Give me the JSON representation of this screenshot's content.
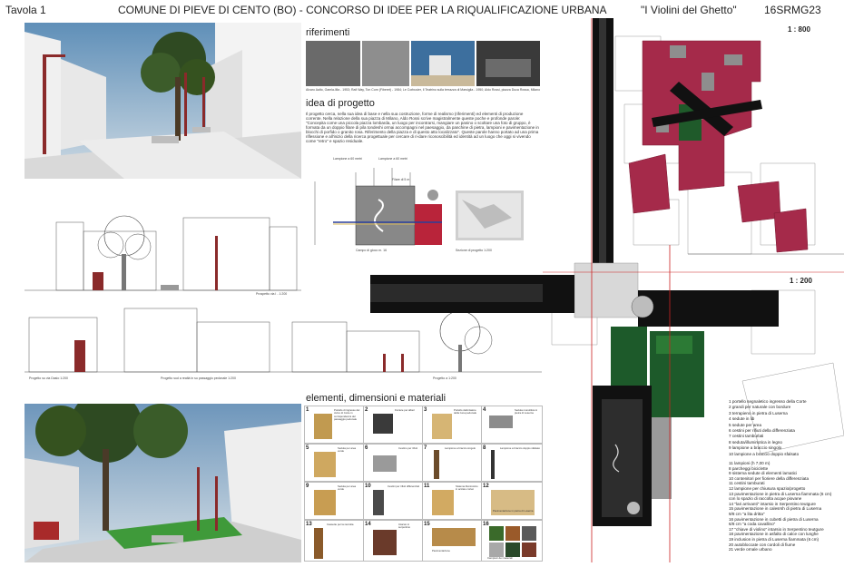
{
  "header": {
    "sheet": "Tavola 1",
    "title": "COMUNE DI PIEVE DI CENTO (BO) - CONCORSO DI IDEE PER LA RIQUALIFICAZIONE URBANA",
    "project": "\"I Violini del Ghetto\"",
    "code": "16SRMG23"
  },
  "sections": {
    "references": "riferimenti",
    "concept": "idea di progetto",
    "materials": "elementi, dimensioni e materiali"
  },
  "references_caption": "Alvaro Aalto, Gamla-lilla - 1953; Rafi Way, Ton Corn (Fiberet) - 1984; Le Corbusier, Il Teatrino sulla terrazza di Marsiglia - 1950; Aldo Rossi, piazza Duca Rossa, Milano - 1990",
  "concept_text": "Il progetto cerca, nella sua idea di base e nella sua costruzione, forme di realismo (riferimenti) ed elementi di produzione corrente. Nella relazione della sua piazza di Milano, Aldo Rossi scrive magistralmente queste poche e profonde parole: \"Concepita come una piccola piazza lombarda, un luogo per incontrarsi, mangiare un panino o scoltare una foto di gruppo, è formata da un doppio filare di pila tondeshi ormai accompagni nel paesaggio, da panchine di pietra, lampioni e pavimentazione in blocchi di porfido o granito rosa. Riferimento della piazza e di questo atto localizzato\". Queste parole hanno portato ad una prima riflessione e all'inizio della ricerca progettuale per cercare di ri-dare riconoscibilità ed identità ad un luogo che oggi si vivendo come \"retro\" e spazio residuale.",
  "drawing_labels": {
    "elev_caption_1": "Prospetto via I - 1:200",
    "elev_caption_2": "Progetto su via Dasio 1:200",
    "elev_caption_3": "Progetto sud a realtà in su passaggio pedonale 1:200",
    "elev_caption_4": "Progetto a 1:200",
    "section_caption": "Sezione di progetto 1:200",
    "light_labels": [
      "Lampione a 60 metri",
      "Lampione a 60 metri",
      "Filare di 5 m",
      "Campo di gioco m. 16",
      "Filare di 5 m"
    ]
  },
  "scales": {
    "top": "1 : 800",
    "bottom": "1 : 200"
  },
  "legend": [
    "1 portello segnaletico ingresso della Corte",
    "2 grandi per naturale con bordure",
    "3 terrapieno in pietra di Luserna",
    "4 sedute in lib",
    "5 sedute per area",
    "6 cestini per rifiuti della differenziata",
    "7 cestini tamburlati",
    "8 seduta/illuminotica in legno",
    "9 lampione a braccio singolo",
    "10 lampione a braccio doppio sfalsato"
  ],
  "legend2": [
    "11 lampioni (h 7,00 m)",
    "8 parcheggi biciclette",
    "9 sistema sedute di elementi lamatici",
    "10 contenitori per fioriere della differenziata",
    "11 cestini tamburati",
    "12 lampione per chiusura spazio/progetto",
    "13 pavimentazione in pietra di Luserna fiammata (6 cm)",
    "con lo spazio di raccolta acque piovane",
    "14 \"lari arrivanti\" intarsio in Serpentino teutgure",
    "15 pavimentazione in calesrsh di pietra di Luserna",
    "9/8 cm \"a lita dritta\"",
    "16 pavimentazione in cubetti di pietra di Luserna",
    "6/8 cm \"a coda cavallino\"",
    "17 \"chiave di violino\" intarsio in Serpentino teutgure",
    "18 pavimentazione in asfalto di calce con lunghe",
    "19 inclusion in pietra di Luserna fiammata (6 cm)",
    "20 autobloccate con cordoli di fiume",
    "21 verde ornale urbano"
  ],
  "materials": [
    {
      "n": "1",
      "text": "Portello di ingresso del civico di Corte in corrispondenza del passaggio pedonale"
    },
    {
      "n": "2",
      "text": "Fioriere per alberi"
    },
    {
      "n": "3",
      "text": "Portello delimitatore della zona pedonale"
    },
    {
      "n": "4",
      "text": "Seduta monolitica in pietra di Luserna"
    },
    {
      "n": "5",
      "text": "Seduta per area verde"
    },
    {
      "n": "6",
      "text": "Cestino per rifiuti"
    },
    {
      "n": "7",
      "text": "Lampione a braccio singolo"
    },
    {
      "n": "8",
      "text": "Lampione a braccio doppio sfalsato"
    },
    {
      "n": "9",
      "text": "Seduta per area verde"
    },
    {
      "n": "10",
      "text": "Cestini per rifiuti differenziati"
    },
    {
      "n": "11",
      "text": "Sistema illuminotico in acciaio corten"
    },
    {
      "n": "12",
      "text": "Pavimentazione in pietra di Luserna"
    },
    {
      "n": "13",
      "text": "Cassette per la raccolta"
    },
    {
      "n": "14",
      "text": "Intarsio in serpentino"
    },
    {
      "n": "15",
      "text": "Pavimentazione"
    },
    {
      "n": "16",
      "text": "Campioni dei materiali"
    }
  ]
}
